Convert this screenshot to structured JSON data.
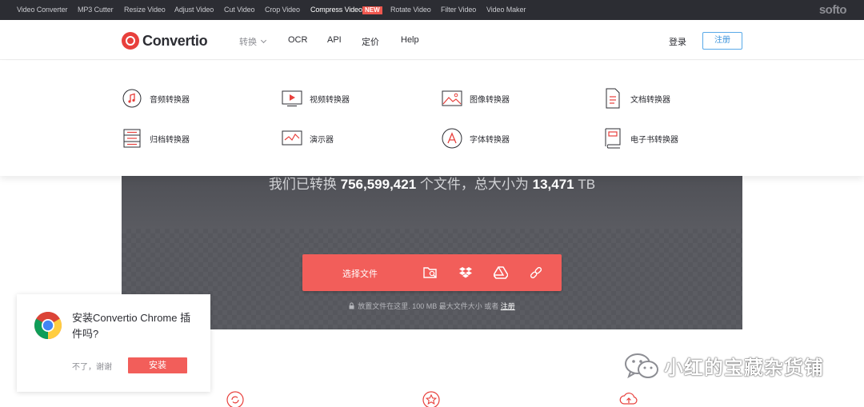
{
  "topbar": {
    "links": [
      "Video Converter",
      "MP3 Cutter",
      "Resize Video",
      "Adjust Video",
      "Cut Video",
      "Crop Video",
      "Compress Video",
      "Rotate Video",
      "Filter Video",
      "Video Maker"
    ],
    "new_badge": "NEW",
    "brand": "softo"
  },
  "nav": {
    "logo": "Convertio",
    "convert": "转换",
    "ocr": "OCR",
    "api": "API",
    "pricing": "定价",
    "help": "Help",
    "login": "登录",
    "register": "注册"
  },
  "menu": {
    "items": [
      {
        "label": "音频转换器",
        "icon": "audio-icon"
      },
      {
        "label": "视频转换器",
        "icon": "video-icon"
      },
      {
        "label": "图像转换器",
        "icon": "image-icon"
      },
      {
        "label": "文档转换器",
        "icon": "document-icon"
      },
      {
        "label": "归档转换器",
        "icon": "archive-icon"
      },
      {
        "label": "演示器",
        "icon": "presentation-icon"
      },
      {
        "label": "字体转换器",
        "icon": "font-icon"
      },
      {
        "label": "电子书转换器",
        "icon": "ebook-icon"
      }
    ]
  },
  "hero": {
    "stats_prefix": "我们已转换",
    "files_count": "756,599,421",
    "stats_middle": "个文件，总大小为",
    "total_size": "13,471",
    "size_unit": "TB",
    "upload_label": "选择文件",
    "hint_text": "放置文件在这里. 100 MB 最大文件大小 或者",
    "hint_register": "注册"
  },
  "popup": {
    "title": "安装Convertio Chrome 插件吗?",
    "decline": "不了，谢谢",
    "install": "安装"
  },
  "watermark": {
    "text": "小红的宝藏杂货铺"
  },
  "colors": {
    "accent": "#f25e5a",
    "topbar": "#2c2d33",
    "hero": "#56575d"
  }
}
